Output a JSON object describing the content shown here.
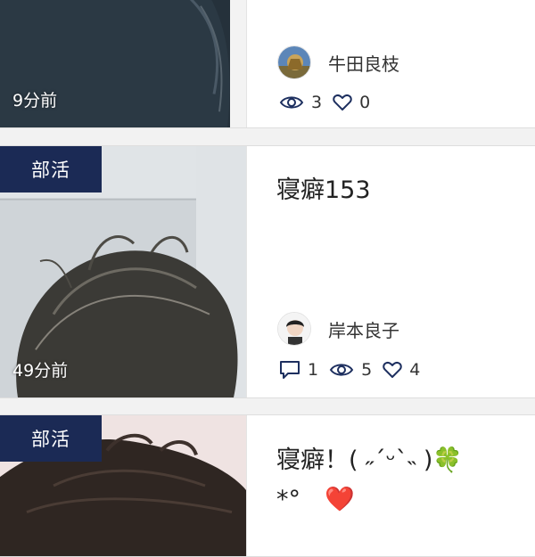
{
  "posts": [
    {
      "tag": "",
      "time": "9分前",
      "title": "",
      "author": "牛田良枝",
      "comments": "",
      "views": "3",
      "likes": "0"
    },
    {
      "tag": "部活",
      "time": "49分前",
      "title": "寝癖153",
      "author": "岸本良子",
      "comments": "1",
      "views": "5",
      "likes": "4"
    },
    {
      "tag": "部活",
      "time": "",
      "title": "寝癖！( ˶ˊᵕˋ˵ )🍀\n*°　❤️",
      "author": "",
      "comments": "",
      "views": "",
      "likes": ""
    }
  ],
  "icons": {
    "view": "eye-icon",
    "like": "heart-icon",
    "comment": "comment-icon"
  },
  "colors": {
    "tag_bg": "#1b2a55",
    "icon": "#1d2f5f"
  }
}
